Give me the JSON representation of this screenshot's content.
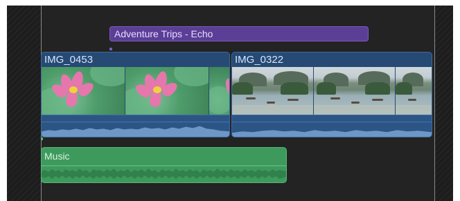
{
  "title_clip": {
    "label": "Adventure Trips - Echo",
    "color": "#5b3e96"
  },
  "video_clips": [
    {
      "name": "IMG_0453",
      "thumbnail": "lotus-flower",
      "color": "#264a73"
    },
    {
      "name": "IMG_0322",
      "thumbnail": "river-boats",
      "color": "#264a73"
    }
  ],
  "audio_clip": {
    "name": "Music",
    "color": "#3d9a5c"
  },
  "colors": {
    "background": "#232323",
    "title_accent": "#7a5cc0",
    "video_border": "#3b6aa0",
    "audio_border": "#56b975"
  }
}
